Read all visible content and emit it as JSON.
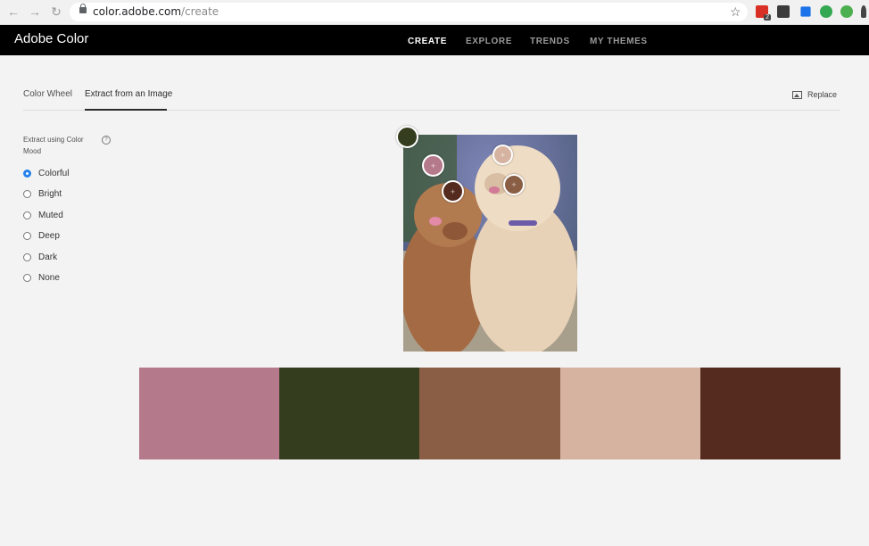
{
  "browser": {
    "url_host": "color.adobe.com",
    "url_path": "/create",
    "ext_badge": "2"
  },
  "app": {
    "brand": "Adobe Color",
    "nav": [
      "CREATE",
      "EXPLORE",
      "TRENDS",
      "MY THEMES"
    ],
    "active_nav": "CREATE"
  },
  "tabs": {
    "items": [
      "Color Wheel",
      "Extract from an Image"
    ],
    "active": "Extract from an Image",
    "replace_label": "Replace"
  },
  "mood": {
    "label": "Extract using Color Mood",
    "options": [
      "Colorful",
      "Bright",
      "Muted",
      "Deep",
      "Dark",
      "None"
    ],
    "selected": "Colorful"
  },
  "swatches": [
    {
      "color": "#b5798c"
    },
    {
      "color": "#343d1e"
    },
    {
      "color": "#895e44"
    },
    {
      "color": "#d5b3a0"
    },
    {
      "color": "#542b1e"
    }
  ],
  "colors": {
    "accent": "#2680eb",
    "header_bg": "#000000"
  }
}
